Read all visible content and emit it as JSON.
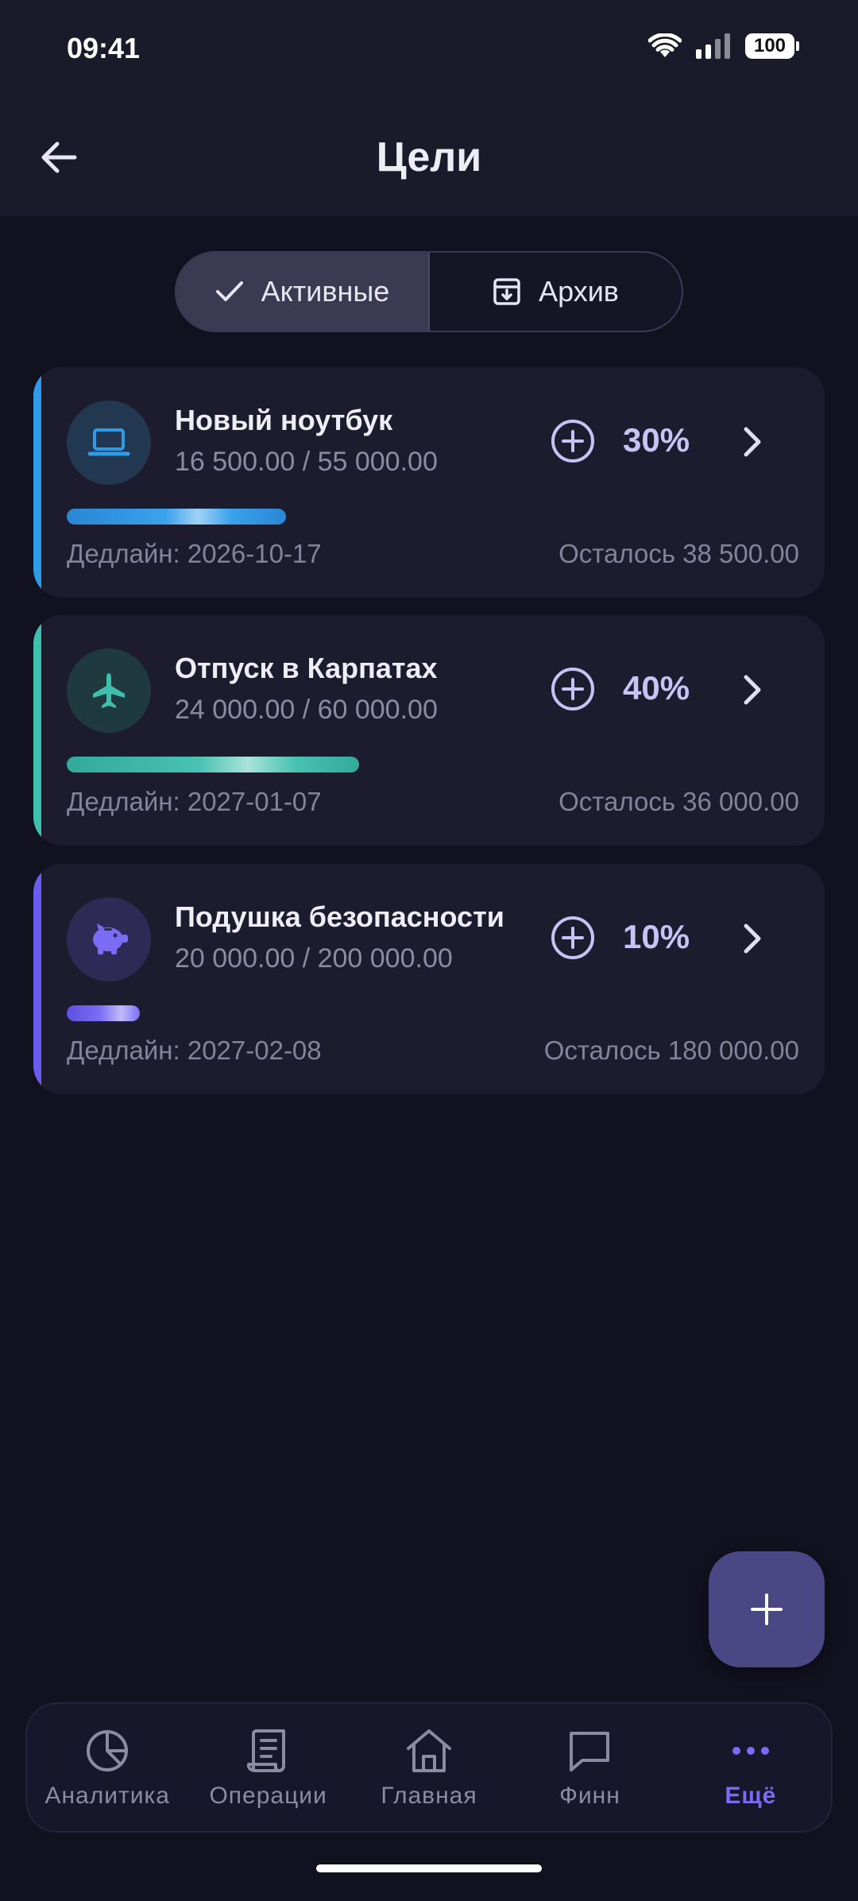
{
  "status": {
    "time": "09:41",
    "battery": "100"
  },
  "header": {
    "title": "Цели"
  },
  "tabs": [
    {
      "label": "Активные",
      "active": true
    },
    {
      "label": "Архив",
      "active": false
    }
  ],
  "goals": [
    {
      "name": "Новый ноутбук",
      "amounts": "16 500.00 / 55 000.00",
      "percent_label": "30%",
      "progress": 0.3,
      "deadline": "Дедлайн: 2026-10-17",
      "remaining": "Осталось 38 500.00",
      "icon": "laptop-icon",
      "accent": "#2f9be8"
    },
    {
      "name": "Отпуск в Карпатах",
      "amounts": "24 000.00 / 60 000.00",
      "percent_label": "40%",
      "progress": 0.4,
      "deadline": "Дедлайн: 2027-01-07",
      "remaining": "Осталось 36 000.00",
      "icon": "airplane-icon",
      "accent": "#3fbfae"
    },
    {
      "name": "Подушка безопасности",
      "amounts": "20 000.00 / 200 000.00",
      "percent_label": "10%",
      "progress": 0.1,
      "deadline": "Дедлайн: 2027-02-08",
      "remaining": "Осталось 180 000.00",
      "icon": "piggy-bank-icon",
      "accent": "#6b5cf0"
    }
  ],
  "nav": [
    {
      "label": "Аналитика",
      "icon": "pie-chart-icon",
      "active": false
    },
    {
      "label": "Операции",
      "icon": "receipt-icon",
      "active": false
    },
    {
      "label": "Главная",
      "icon": "home-icon",
      "active": false
    },
    {
      "label": "Финн",
      "icon": "chat-bubble-icon",
      "active": false
    },
    {
      "label": "Ещё",
      "icon": "more-dots-icon",
      "active": true
    }
  ],
  "colors": {
    "accent": "#7c6cf5",
    "background": "#12111f",
    "card": "#1d1c2f"
  }
}
